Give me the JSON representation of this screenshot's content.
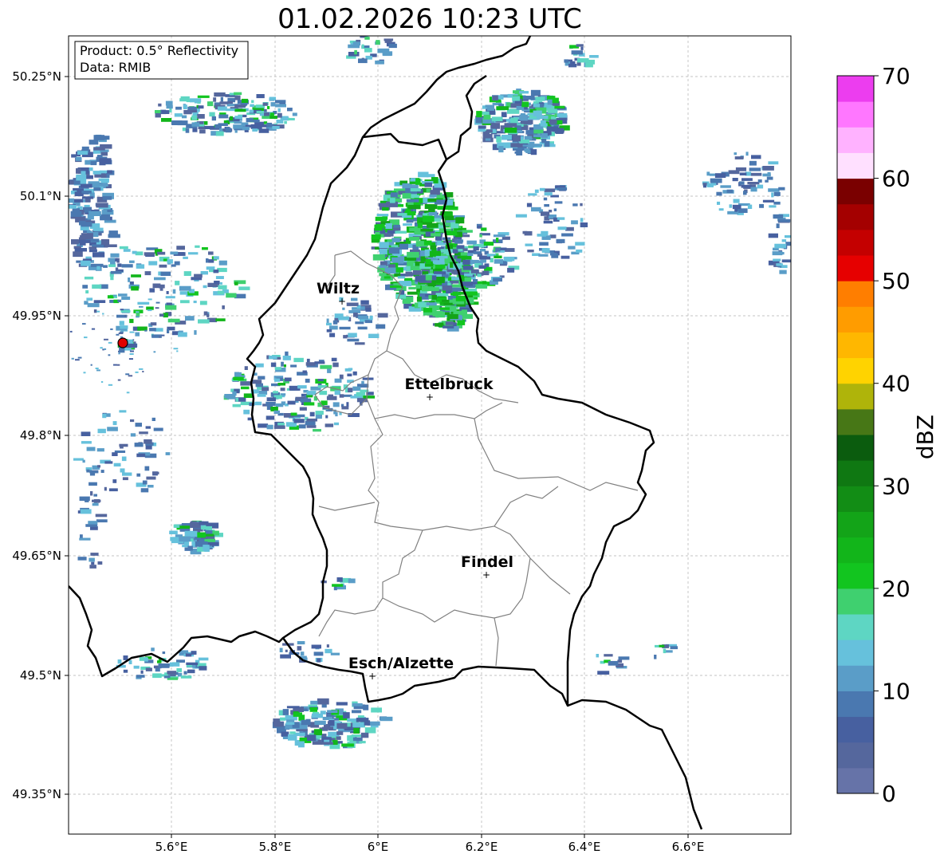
{
  "title": "01.02.2026 10:23 UTC",
  "info_box": {
    "product": "Product: 0.5° Reflectivity",
    "data_source": "Data: RMIB"
  },
  "axes": {
    "lon_ticks": [
      "5.6°E",
      "5.8°E",
      "6°E",
      "6.2°E",
      "6.4°E",
      "6.6°E"
    ],
    "lat_ticks": [
      "50.25°N",
      "50.1°N",
      "49.95°N",
      "49.8°N",
      "49.65°N",
      "49.5°N",
      "49.35°N"
    ]
  },
  "cities": [
    {
      "name": "Wiltz",
      "lon": 5.93,
      "lat": 49.966
    },
    {
      "name": "Ettelbruck",
      "lon": 6.1,
      "lat": 49.847
    },
    {
      "name": "Findel",
      "lon": 6.21,
      "lat": 49.624
    },
    {
      "name": "Esch/Alzette",
      "lon": 5.99,
      "lat": 49.497
    }
  ],
  "radar_site": {
    "lon": 5.505,
    "lat": 49.914,
    "color": "#e00000"
  },
  "colorbar": {
    "label": "dBZ",
    "tick_labels": [
      "0",
      "10",
      "20",
      "30",
      "40",
      "50",
      "60",
      "70"
    ],
    "min": 0,
    "max": 70,
    "step": 2.5,
    "colors": [
      "#6673a8",
      "#55679d",
      "#4760a0",
      "#4a78b0",
      "#5a9dc8",
      "#66c1dc",
      "#5ed6c3",
      "#3fd06f",
      "#12c51f",
      "#12b51a",
      "#13a418",
      "#128d15",
      "#0f7812",
      "#0b5c0e",
      "#477716",
      "#afb40a",
      "#ffd300",
      "#ffb700",
      "#ff9c00",
      "#ff7e00",
      "#e60000",
      "#c40000",
      "#a40000",
      "#7a0000",
      "#ffe0ff",
      "#ffb2ff",
      "#ff77ff",
      "#ec3def"
    ]
  },
  "colors": {
    "border": "#000000",
    "admin_lines": "#808080",
    "grid": "#b0b0b0"
  }
}
